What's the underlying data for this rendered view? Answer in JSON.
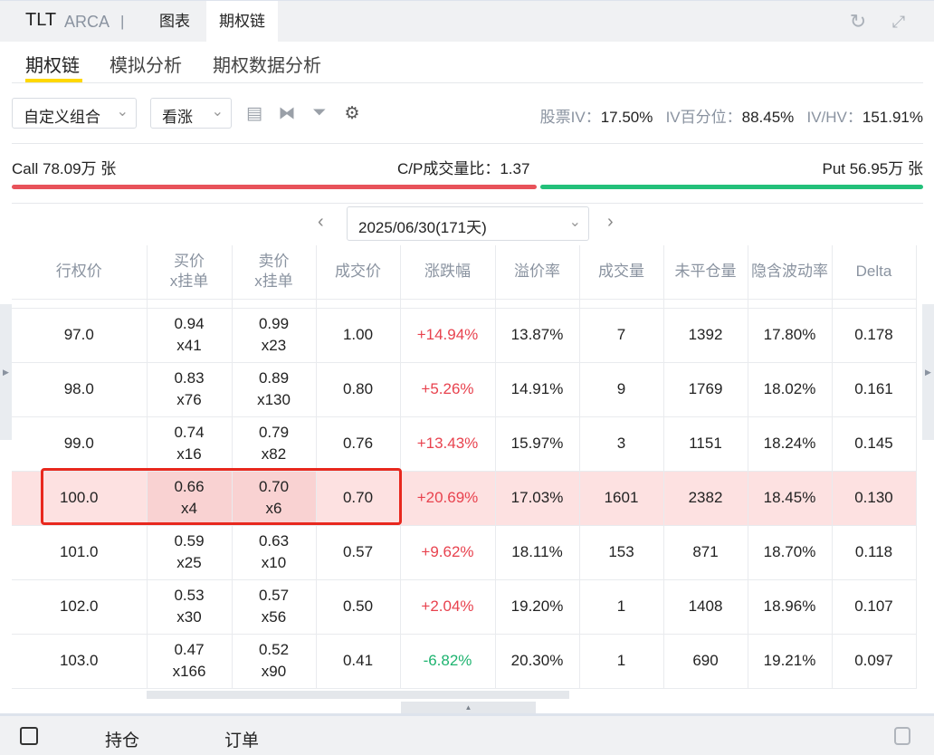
{
  "header": {
    "symbol": "TLT",
    "exchange": "ARCA",
    "separator": "|",
    "tabs": [
      "图表",
      "期权链"
    ]
  },
  "subtabs": [
    "期权链",
    "模拟分析",
    "期权数据分析"
  ],
  "toolbar": {
    "combo": "自定义组合",
    "direction": "看涨",
    "iv_label": "股票IV：",
    "iv": "17.50%",
    "ivp_label": "IV百分位：",
    "ivp": "88.45%",
    "ivhv_label": "IV/HV：",
    "ivhv": "151.91%"
  },
  "volume": {
    "call": "Call 78.09万 张",
    "ratio": "C/P成交量比：1.37",
    "put": "Put 56.95万 张",
    "call_color": "#e8525a",
    "put_color": "#23c07a",
    "call_fraction": 0.578
  },
  "expiry": "2025/06/30(171天)",
  "columns": [
    "行权价",
    "买价\nx挂单",
    "卖价\nx挂单",
    "成交价",
    "涨跌幅",
    "溢价率",
    "成交量",
    "未平仓量",
    "隐含波动率",
    "Delta"
  ],
  "column_lines": [
    [
      "行权价"
    ],
    [
      "买价",
      "x挂单"
    ],
    [
      "卖价",
      "x挂单"
    ],
    [
      "成交价"
    ],
    [
      "涨跌幅"
    ],
    [
      "溢价率"
    ],
    [
      "成交量"
    ],
    [
      "未平仓量"
    ],
    [
      "隐含波动率"
    ],
    [
      "Delta"
    ]
  ],
  "rows": [
    {
      "strike": "97.0",
      "bid": "0.94",
      "bid_size": "x41",
      "ask": "0.99",
      "ask_size": "x23",
      "last": "1.00",
      "change": "+14.94%",
      "dir": "up",
      "premium": "13.87%",
      "vol": "7",
      "oi": "1392",
      "iv": "17.80%",
      "delta": "0.178"
    },
    {
      "strike": "98.0",
      "bid": "0.83",
      "bid_size": "x76",
      "ask": "0.89",
      "ask_size": "x130",
      "last": "0.80",
      "change": "+5.26%",
      "dir": "up",
      "premium": "14.91%",
      "vol": "9",
      "oi": "1769",
      "iv": "18.02%",
      "delta": "0.161"
    },
    {
      "strike": "99.0",
      "bid": "0.74",
      "bid_size": "x16",
      "ask": "0.79",
      "ask_size": "x82",
      "last": "0.76",
      "change": "+13.43%",
      "dir": "up",
      "premium": "15.97%",
      "vol": "3",
      "oi": "1151",
      "iv": "18.24%",
      "delta": "0.145"
    },
    {
      "strike": "100.0",
      "bid": "0.66",
      "bid_size": "x4",
      "ask": "0.70",
      "ask_size": "x6",
      "last": "0.70",
      "change": "+20.69%",
      "dir": "up",
      "premium": "17.03%",
      "vol": "1601",
      "oi": "2382",
      "iv": "18.45%",
      "delta": "0.130",
      "highlight": true
    },
    {
      "strike": "101.0",
      "bid": "0.59",
      "bid_size": "x25",
      "ask": "0.63",
      "ask_size": "x10",
      "last": "0.57",
      "change": "+9.62%",
      "dir": "up",
      "premium": "18.11%",
      "vol": "153",
      "oi": "871",
      "iv": "18.70%",
      "delta": "0.118"
    },
    {
      "strike": "102.0",
      "bid": "0.53",
      "bid_size": "x30",
      "ask": "0.57",
      "ask_size": "x56",
      "last": "0.50",
      "change": "+2.04%",
      "dir": "up",
      "premium": "19.20%",
      "vol": "1",
      "oi": "1408",
      "iv": "18.96%",
      "delta": "0.107"
    },
    {
      "strike": "103.0",
      "bid": "0.47",
      "bid_size": "x166",
      "ask": "0.52",
      "ask_size": "x90",
      "last": "0.41",
      "change": "-6.82%",
      "dir": "dn",
      "premium": "20.30%",
      "vol": "1",
      "oi": "690",
      "iv": "19.21%",
      "delta": "0.097"
    }
  ],
  "bottom": {
    "tabs": [
      "持仓",
      "订单"
    ]
  }
}
